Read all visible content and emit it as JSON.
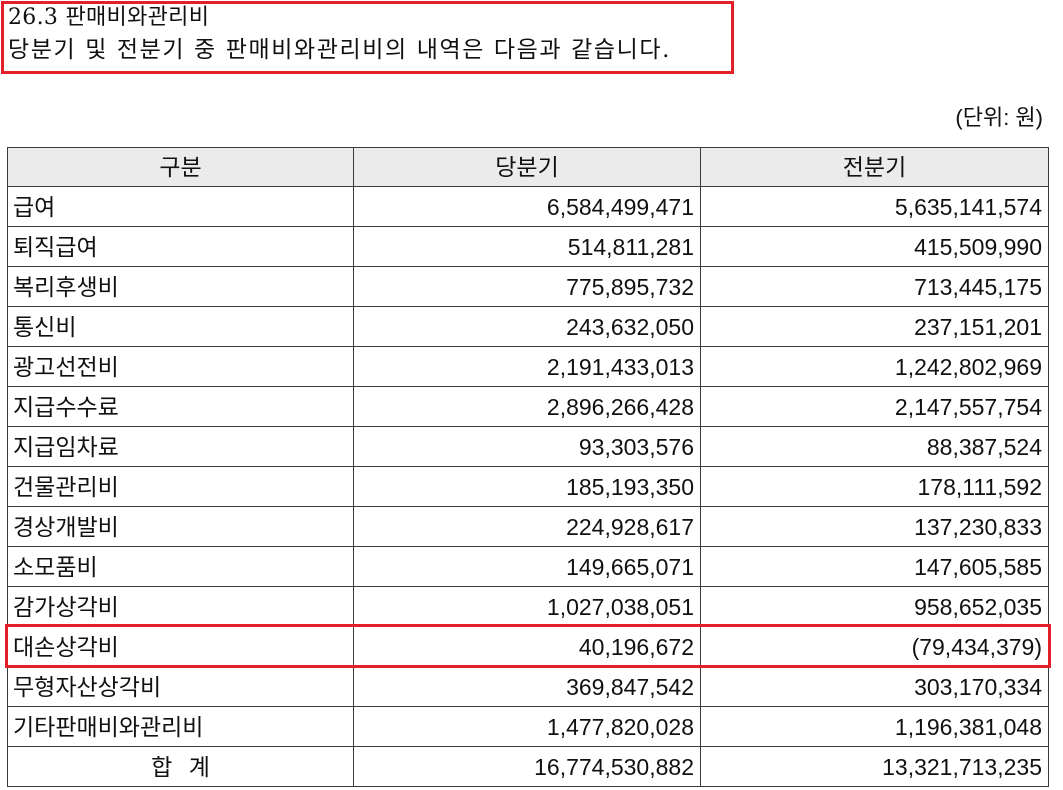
{
  "section": {
    "heading": "26.3 판매비와관리비",
    "description": "당분기 및 전분기 중 판매비와관리비의 내역은 다음과 같습니다.",
    "highlighted": true
  },
  "unit_note": "(단위: 원)",
  "table": {
    "columns": [
      "구분",
      "당분기",
      "전분기"
    ],
    "rows": [
      {
        "item": "급여",
        "current_quarter": "6,584,499,471",
        "prior_quarter": "5,635,141,574"
      },
      {
        "item": "퇴직급여",
        "current_quarter": "514,811,281",
        "prior_quarter": "415,509,990"
      },
      {
        "item": "복리후생비",
        "current_quarter": "775,895,732",
        "prior_quarter": "713,445,175"
      },
      {
        "item": "통신비",
        "current_quarter": "243,632,050",
        "prior_quarter": "237,151,201"
      },
      {
        "item": "광고선전비",
        "current_quarter": "2,191,433,013",
        "prior_quarter": "1,242,802,969"
      },
      {
        "item": "지급수수료",
        "current_quarter": "2,896,266,428",
        "prior_quarter": "2,147,557,754"
      },
      {
        "item": "지급임차료",
        "current_quarter": "93,303,576",
        "prior_quarter": "88,387,524"
      },
      {
        "item": "건물관리비",
        "current_quarter": "185,193,350",
        "prior_quarter": "178,111,592"
      },
      {
        "item": "경상개발비",
        "current_quarter": "224,928,617",
        "prior_quarter": "137,230,833"
      },
      {
        "item": "소모품비",
        "current_quarter": "149,665,071",
        "prior_quarter": "147,605,585"
      },
      {
        "item": "감가상각비",
        "current_quarter": "1,027,038,051",
        "prior_quarter": "958,652,035"
      },
      {
        "item": "대손상각비",
        "current_quarter": "40,196,672",
        "prior_quarter": "(79,434,379)",
        "highlighted": true
      },
      {
        "item": "무형자산상각비",
        "current_quarter": "369,847,542",
        "prior_quarter": "303,170,334"
      },
      {
        "item": "기타판매비와관리비",
        "current_quarter": "1,477,820,028",
        "prior_quarter": "1,196,381,048"
      }
    ],
    "total": {
      "item": "합 계",
      "current_quarter": "16,774,530,882",
      "prior_quarter": "13,321,713,235"
    }
  },
  "colors": {
    "highlight_border": "#e3202a",
    "header_background": "#ebebeb",
    "grid_line": "#3c3c3c",
    "text": "#111111"
  }
}
